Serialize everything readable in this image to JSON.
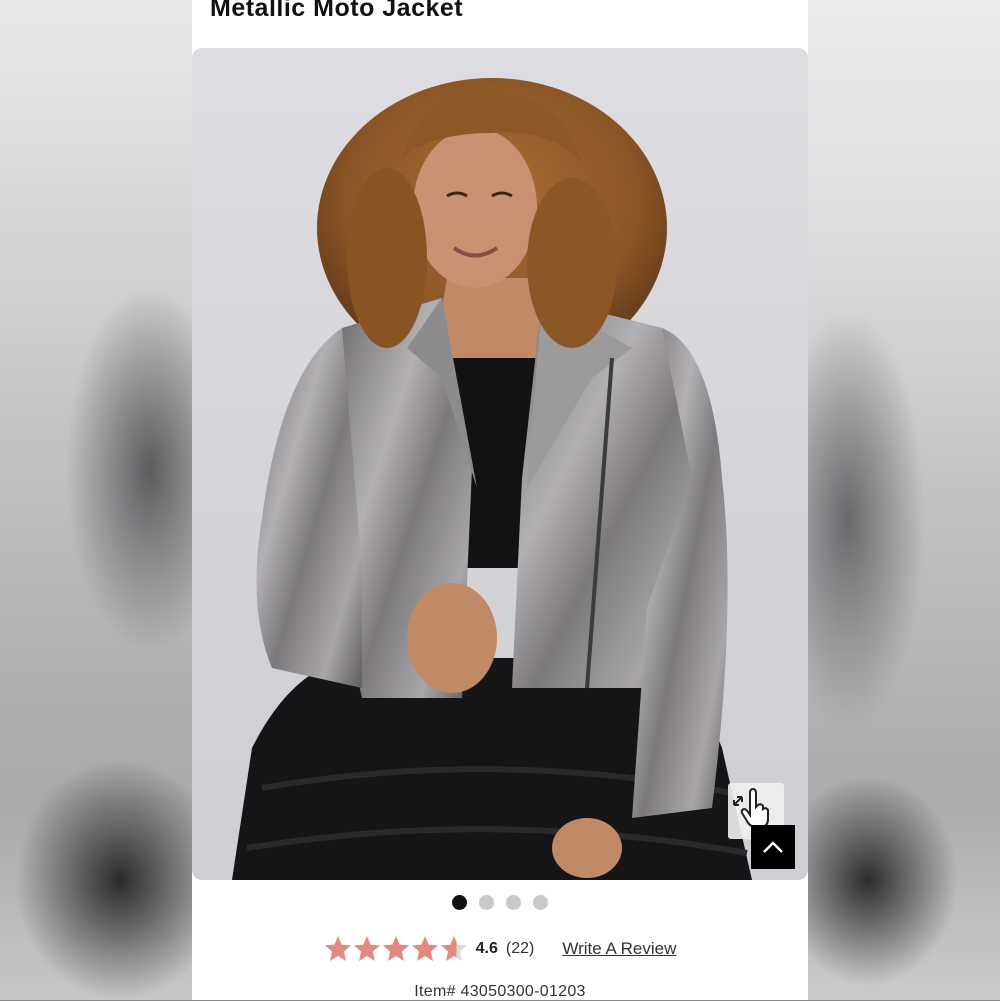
{
  "product": {
    "title": "Metallic Moto Jacket"
  },
  "gallery": {
    "image_alt": "Model wearing metallic moto jacket over black lace dress",
    "slide_count": 4,
    "active_slide": 1,
    "zoom_icon": "expand-hand-icon",
    "scroll_top_icon": "chevron-up-icon"
  },
  "rating": {
    "value": "4.6",
    "stars_filled": 4.6,
    "star_color": "#e08a82",
    "count": "(22)",
    "write_review_label": "Write A Review"
  },
  "item": {
    "label": "Item# 43050300-01203"
  },
  "colors": {
    "page_bg": "#ffffff",
    "active_dot": "#111111",
    "inactive_dot": "#c9c9c9"
  }
}
